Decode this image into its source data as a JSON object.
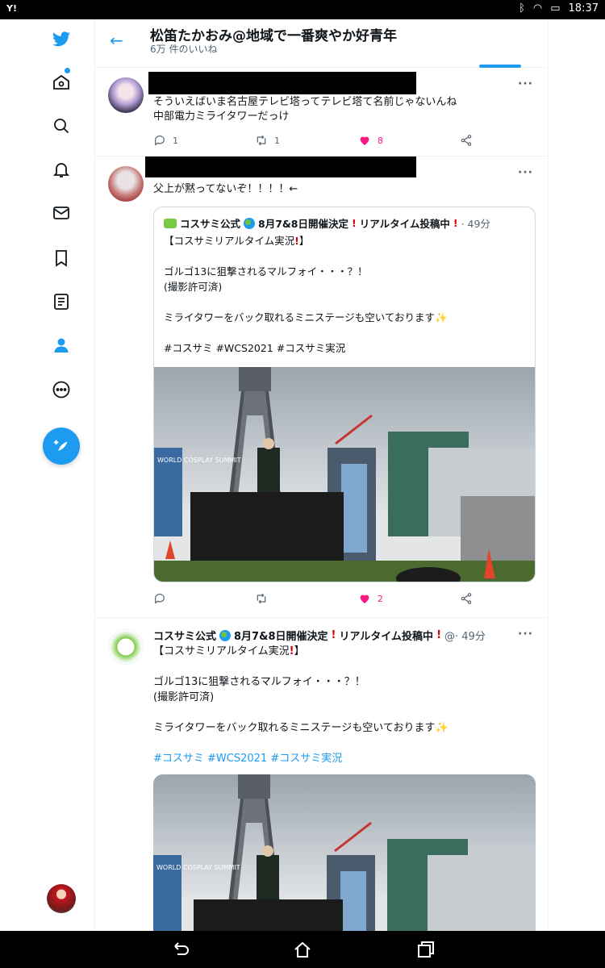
{
  "status_bar": {
    "carrier": "Y!",
    "time": "18:37"
  },
  "header": {
    "title": "松笛たかおみ@地域で一番爽やか好青年",
    "subtitle": "6万 件のいいね"
  },
  "tweets": [
    {
      "text": "そういえばいま名古屋テレビ塔ってテレビ塔て名前じゃないんね\n中部電力ミライタワーだっけ",
      "replies": "1",
      "retweets": "1",
      "likes": "8"
    },
    {
      "text": "父上が黙ってないぞ！！！！←",
      "quote": {
        "name": "コスサミ公式",
        "name_suffix": "8月7&8日開催決定",
        "name_tail": "リアルタイム投稿中",
        "time": "· 49分",
        "line1": "【コスサミリアルタイム実況",
        "line1_end": "】",
        "body": "ゴルゴ13に狙撃されるマルフォイ・・・？！\n(撮影許可済)\n\nミライタワーをバック取れるミニステージも空いております✨",
        "hashtags": "#コスサミ #WCS2021 #コスサミ実況"
      },
      "replies": "",
      "retweets": "",
      "likes": "2"
    },
    {
      "name": "コスサミ公式",
      "name_suffix": "8月7&8日開催決定",
      "name_tail": "リアルタイム投稿中",
      "handle_time": "@· 49分",
      "line1": "【コスサミリアルタイム実況",
      "line1_end": "】",
      "body": "ゴルゴ13に狙撃されるマルフォイ・・・？！\n(撮影許可済)\n\nミライタワーをバック取れるミニステージも空いております✨",
      "hashtags": "#コスサミ #WCS2021 #コスサミ実況"
    }
  ],
  "photo": {
    "banner_text": "WORLD COSPLAY SUMMIT"
  },
  "colors": {
    "accent": "#1d9bf0",
    "like": "#f91880",
    "text": "#0f1419",
    "secondary": "#536471"
  }
}
